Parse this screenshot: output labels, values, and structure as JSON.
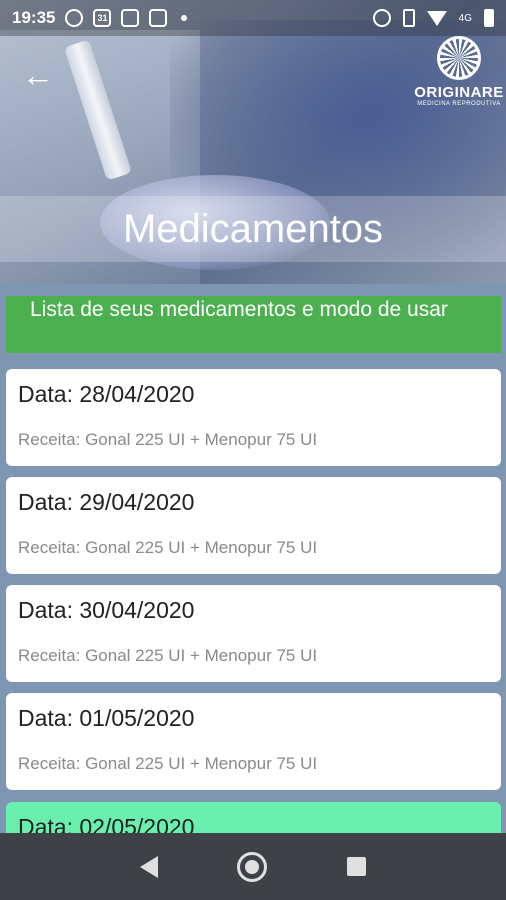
{
  "status_bar": {
    "time": "19:35",
    "calendar_day": "31",
    "network": "4G"
  },
  "header": {
    "title": "Medicamentos",
    "logo_name": "ORIGINARE",
    "logo_subtitle": "MEDICINA REPRODUTIVA"
  },
  "banner": {
    "text": "Lista de seus medicamentos e modo de usar"
  },
  "entries": [
    {
      "date": "Data: 28/04/2020",
      "recipe": "Receita: Gonal 225 UI + Menopur 75 UI"
    },
    {
      "date": "Data: 29/04/2020",
      "recipe": "Receita: Gonal 225 UI + Menopur 75 UI"
    },
    {
      "date": "Data: 30/04/2020",
      "recipe": "Receita: Gonal 225 UI + Menopur 75 UI"
    },
    {
      "date": "Data: 01/05/2020",
      "recipe": "Receita: Gonal 225 UI + Menopur 75 UI"
    },
    {
      "date": "Data: 02/05/2020",
      "recipe": ""
    }
  ],
  "colors": {
    "banner": "#4caf50",
    "highlight_card": "#69f0ae",
    "background": "#7f96b3",
    "navbar": "#3e4247"
  },
  "icons": {
    "back": "arrow-left-icon",
    "nav_back": "triangle-back-icon",
    "nav_home": "circle-home-icon",
    "nav_recent": "square-recent-icon"
  }
}
